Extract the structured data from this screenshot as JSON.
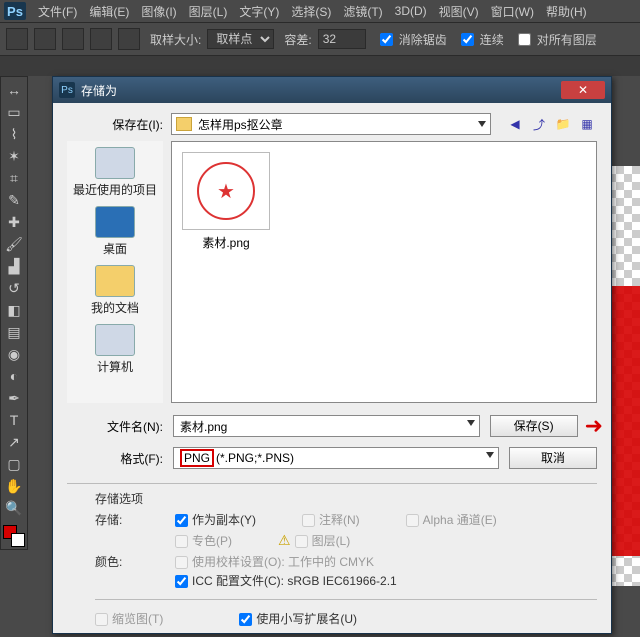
{
  "menubar": {
    "items": [
      "文件(F)",
      "编辑(E)",
      "图像(I)",
      "图层(L)",
      "文字(Y)",
      "选择(S)",
      "滤镜(T)",
      "3D(D)",
      "视图(V)",
      "窗口(W)",
      "帮助(H)"
    ]
  },
  "optionsbar": {
    "sample_size_label": "取样大小:",
    "sample_size_value": "取样点",
    "tolerance_label": "容差:",
    "tolerance_value": "32",
    "antialias": "消除锯齿",
    "contiguous": "连续",
    "all_layers": "对所有图层"
  },
  "dialog": {
    "title": "存储为",
    "close_glyph": "✕",
    "save_in_label": "保存在(I):",
    "folder_name": "怎样用ps抠公章",
    "places": [
      {
        "label": "最近使用的项目"
      },
      {
        "label": "桌面"
      },
      {
        "label": "我的文档"
      },
      {
        "label": "计算机"
      }
    ],
    "file_item_label": "素材.png",
    "filename_label": "文件名(N):",
    "filename_value": "素材.png",
    "format_label": "格式(F):",
    "format_prefix": "PNG",
    "format_rest": "(*.PNG;*.PNS)",
    "save_btn": "保存(S)",
    "cancel_btn": "取消",
    "opts_header": "存储选项",
    "store_label": "存储:",
    "as_copy": "作为副本(Y)",
    "notes": "注释(N)",
    "alpha": "Alpha 通道(E)",
    "spot": "专色(P)",
    "layers": "图层(L)",
    "color_label": "颜色:",
    "proof": "使用校样设置(O): 工作中的 CMYK",
    "icc": "ICC 配置文件(C): sRGB IEC61966-2.1",
    "thumbnail": "缩览图(T)",
    "lowercase_ext": "使用小写扩展名(U)"
  }
}
